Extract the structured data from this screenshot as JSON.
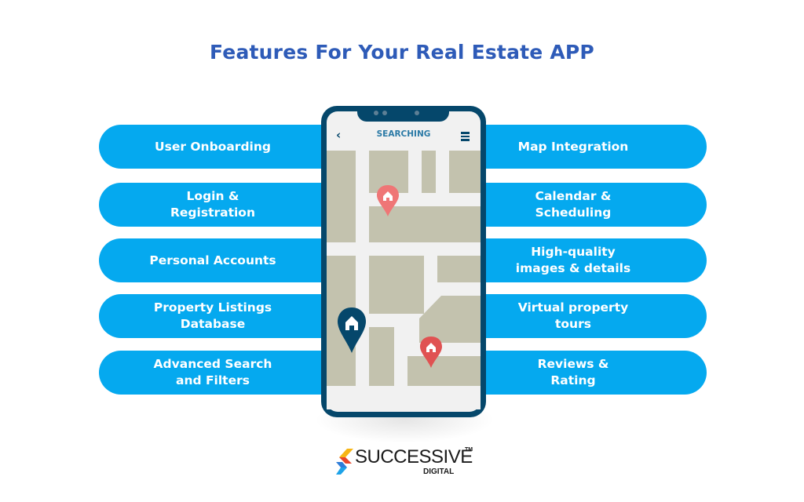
{
  "title": "Features For Your Real Estate APP",
  "features_left": [
    {
      "label": "User Onboarding"
    },
    {
      "label": "Login &\nRegistration"
    },
    {
      "label": "Personal Accounts"
    },
    {
      "label": "Property Listings\nDatabase"
    },
    {
      "label": "Advanced Search\nand Filters"
    }
  ],
  "features_right": [
    {
      "label": "Map Integration"
    },
    {
      "label": "Calendar &\nScheduling"
    },
    {
      "label": "High-quality\nimages & details"
    },
    {
      "label": "Virtual property\ntours"
    },
    {
      "label": "Reviews &\nRating"
    }
  ],
  "phone": {
    "screen_title": "SEARCHING",
    "back_icon": "chevron-left-icon",
    "menu_icon": "hamburger-menu-icon",
    "map_pins": [
      {
        "type": "property",
        "color": "#ef7676"
      },
      {
        "type": "current-location",
        "color": "#05476b"
      },
      {
        "type": "property",
        "color": "#e05252"
      }
    ]
  },
  "colors": {
    "title": "#2e5bb8",
    "pill": "#05a9ef",
    "phone_frame": "#05476b",
    "map_block": "#c3c2ae",
    "road": "#f1f1f1"
  },
  "brand": {
    "name": "SUCCESSIVE",
    "trademark": "TM",
    "sub": "DIGITAL"
  }
}
